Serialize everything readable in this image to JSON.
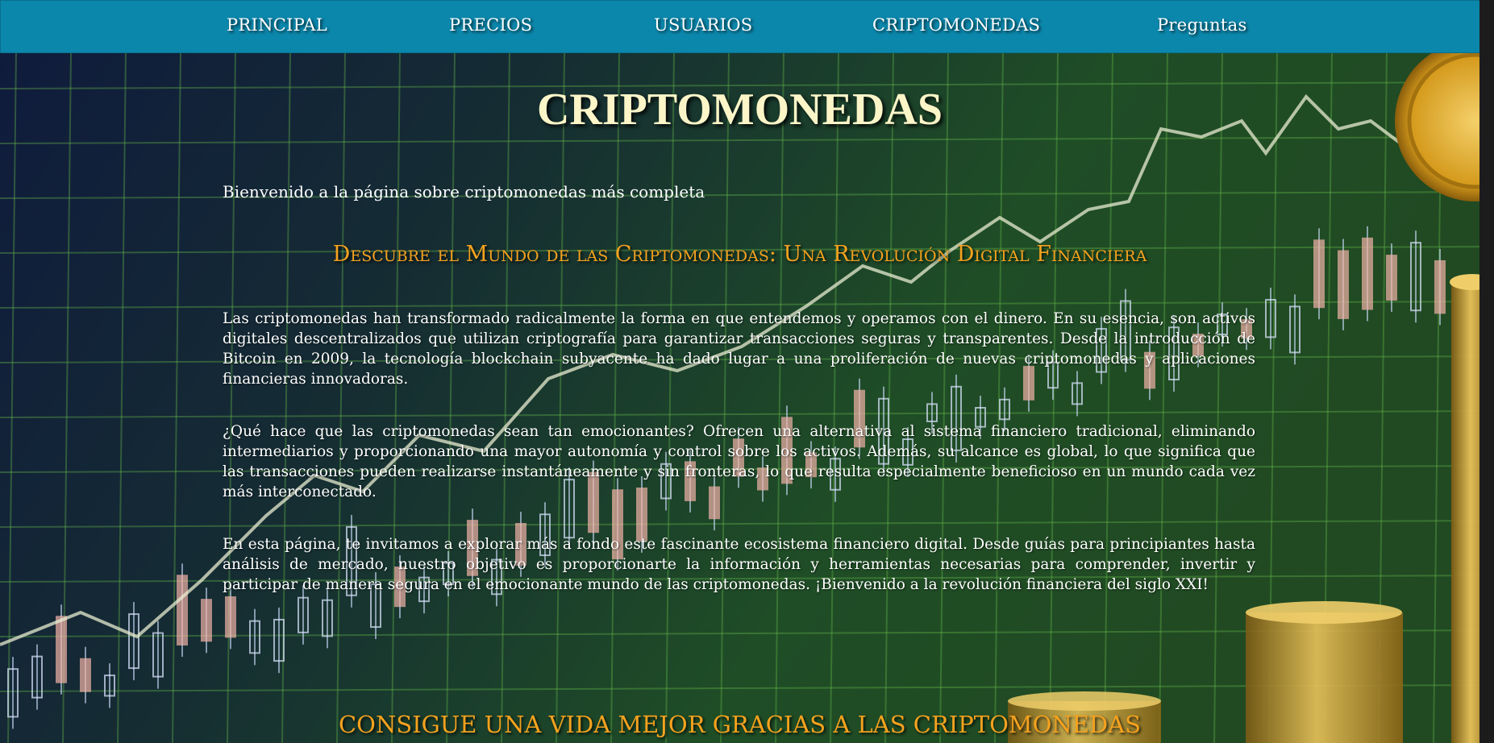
{
  "nav": {
    "items": [
      {
        "label": "PRINCIPAL"
      },
      {
        "label": "PRECIOS"
      },
      {
        "label": "USUARIOS"
      },
      {
        "label": "CRIPTOMONEDAS"
      },
      {
        "label": "Preguntas"
      }
    ]
  },
  "main": {
    "title": "CRIPTOMONEDAS",
    "welcome": "Bienvenido a la página sobre criptomonedas más completa",
    "subtitle": "Descubre el Mundo de las Criptomonedas: Una Revolución Digital Financiera",
    "paragraphs": [
      "Las criptomonedas han transformado radicalmente la forma en que entendemos y operamos con el dinero. En su esencia, son activos digitales descentralizados que utilizan criptografía para garantizar transacciones seguras y transparentes. Desde la introducción de Bitcoin en 2009, la tecnología blockchain subyacente ha dado lugar a una proliferación de nuevas criptomonedas y aplicaciones financieras innovadoras.",
      "¿Qué hace que las criptomonedas sean tan emocionantes? Ofrecen una alternativa al sistema financiero tradicional, eliminando intermediarios y proporcionando una mayor autonomía y control sobre los activos. Además, su alcance es global, lo que significa que las transacciones pueden realizarse instantáneamente y sin fronteras, lo que resulta especialmente beneficioso en un mundo cada vez más interconectado.",
      "En esta página, te invitamos a explorar más a fondo este fascinante ecosistema financiero digital. Desde guías para principiantes hasta análisis de mercado, nuestro objetivo es proporcionarte la información y herramientas necesarias para comprender, invertir y participar de manera segura en el emocionante mundo de las criptomonedas. ¡Bienvenido a la revolución financiera del siglo XXI!"
    ],
    "section_title": "CONSIGUE UNA VIDA MEJOR GRACIAS A LAS CRIPTOMONEDAS"
  },
  "theme": {
    "nav_bg": "#0b87ab",
    "title_color": "#fcf5c8",
    "accent_orange": "#f5a21e",
    "bg_green": "#1d4a24",
    "bg_navy": "#0e1838",
    "gold": "#d9a726"
  }
}
